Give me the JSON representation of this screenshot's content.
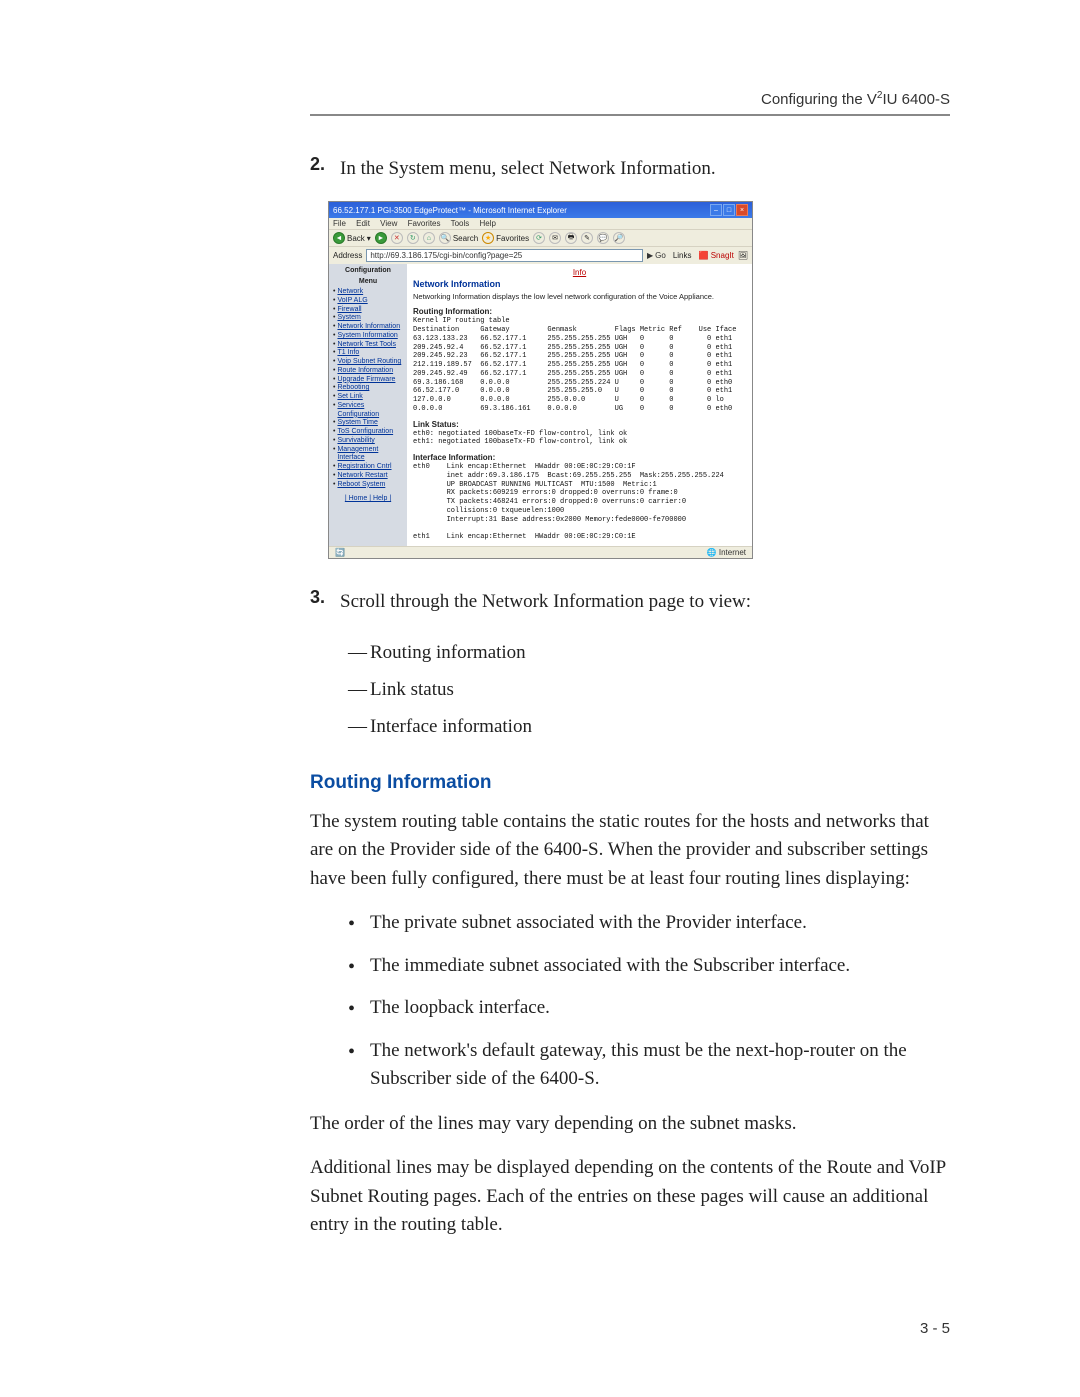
{
  "header": {
    "product_prefix": "Configuring the V",
    "product_sup": "2",
    "product_suffix": "IU 6400-S"
  },
  "step2": {
    "num": "2.",
    "text": "In the System menu, select Network Information."
  },
  "screenshot": {
    "title": "66.52.177.1 PGI-3500 EdgeProtect™ - Microsoft Internet Explorer",
    "menubar": [
      "File",
      "Edit",
      "View",
      "Favorites",
      "Tools",
      "Help"
    ],
    "toolbar": {
      "back": "Back",
      "search": "Search",
      "favorites": "Favorites"
    },
    "address_label": "Address",
    "address_value": "http://69.3.186.175/cgi-bin/config?page=25",
    "go": "Go",
    "links": "Links",
    "snagit": "SnagIt",
    "sidebar_header_1": "Configuration",
    "sidebar_header_2": "Menu",
    "sidebar_items": [
      "Network",
      "VoIP ALG",
      "Firewall",
      "System",
      "Network Information",
      "System Information",
      "Network Test Tools",
      "T1 Info",
      "Voip Subnet Routing",
      "Route Information",
      "Upgrade Firmware",
      "Rebooting",
      "Set Link",
      "Services Configuration",
      "System Time",
      "ToS Configuration",
      "Survivability",
      "Management Interface",
      "Registration Cntrl",
      "Network Restart",
      "Reboot System"
    ],
    "sidebar_footer": "| Home | Help |",
    "info_link": "Info",
    "main_title": "Network Information",
    "main_sub": "Networking Information displays the low level network configuration of the Voice Appliance.",
    "routing_hdr": "Routing Information:",
    "routing_table": "Kernel IP routing table\nDestination     Gateway         Genmask         Flags Metric Ref    Use Iface\n63.123.133.23   66.52.177.1     255.255.255.255 UGH   0      0        0 eth1\n209.245.92.4    66.52.177.1     255.255.255.255 UGH   0      0        0 eth1\n209.245.92.23   66.52.177.1     255.255.255.255 UGH   0      0        0 eth1\n212.119.189.57  66.52.177.1     255.255.255.255 UGH   0      0        0 eth1\n209.245.92.49   66.52.177.1     255.255.255.255 UGH   0      0        0 eth1\n69.3.186.168    0.0.0.0         255.255.255.224 U     0      0        0 eth0\n66.52.177.0     0.0.0.0         255.255.255.0   U     0      0        0 eth1\n127.0.0.0       0.0.0.0         255.0.0.0       U     0      0        0 lo\n0.0.0.0         69.3.186.161    0.0.0.0         UG    0      0        0 eth0",
    "link_hdr": "Link Status:",
    "link_text": "eth0: negotiated 100baseTx-FD flow-control, link ok\neth1: negotiated 100baseTx-FD flow-control, link ok",
    "iface_hdr": "Interface Information:",
    "iface_text": "eth0    Link encap:Ethernet  HWaddr 00:0E:0C:29:C0:1F\n        inet addr:69.3.186.175  Bcast:69.255.255.255  Mask:255.255.255.224\n        UP BROADCAST RUNNING MULTICAST  MTU:1500  Metric:1\n        RX packets:609219 errors:0 dropped:0 overruns:0 frame:0\n        TX packets:468241 errors:0 dropped:0 overruns:0 carrier:0\n        collisions:0 txqueuelen:1000\n        Interrupt:31 Base address:0x2000 Memory:fede0000-fe700000\n\neth1    Link encap:Ethernet  HWaddr 00:0E:0C:29:C0:1E",
    "status_left_icon": "🔄",
    "status_right": "Internet"
  },
  "step3": {
    "num": "3.",
    "text": "Scroll through the Network Information page to view:",
    "items": [
      "Routing information",
      "Link status",
      "Interface information"
    ]
  },
  "routing_section": {
    "heading": "Routing Information",
    "p1": "The system routing table contains the static routes for the hosts and networks that are on the Provider side of the 6400-S. When the provider and subscriber settings have been fully configured, there must be at least four routing lines displaying:",
    "bullets": [
      "The private subnet associated with the Provider interface.",
      "The immediate subnet associated with the Subscriber interface.",
      "The loopback interface.",
      "The network's default gateway, this must be the next-hop-router on the Subscriber side of the 6400-S."
    ],
    "p2": "The order of the lines may vary depending on the subnet masks.",
    "p3": "Additional lines may be displayed depending on the contents of the Route and VoIP Subnet Routing pages. Each of the entries on these pages will cause an additional entry in the routing table."
  },
  "pagenum": "3 - 5"
}
